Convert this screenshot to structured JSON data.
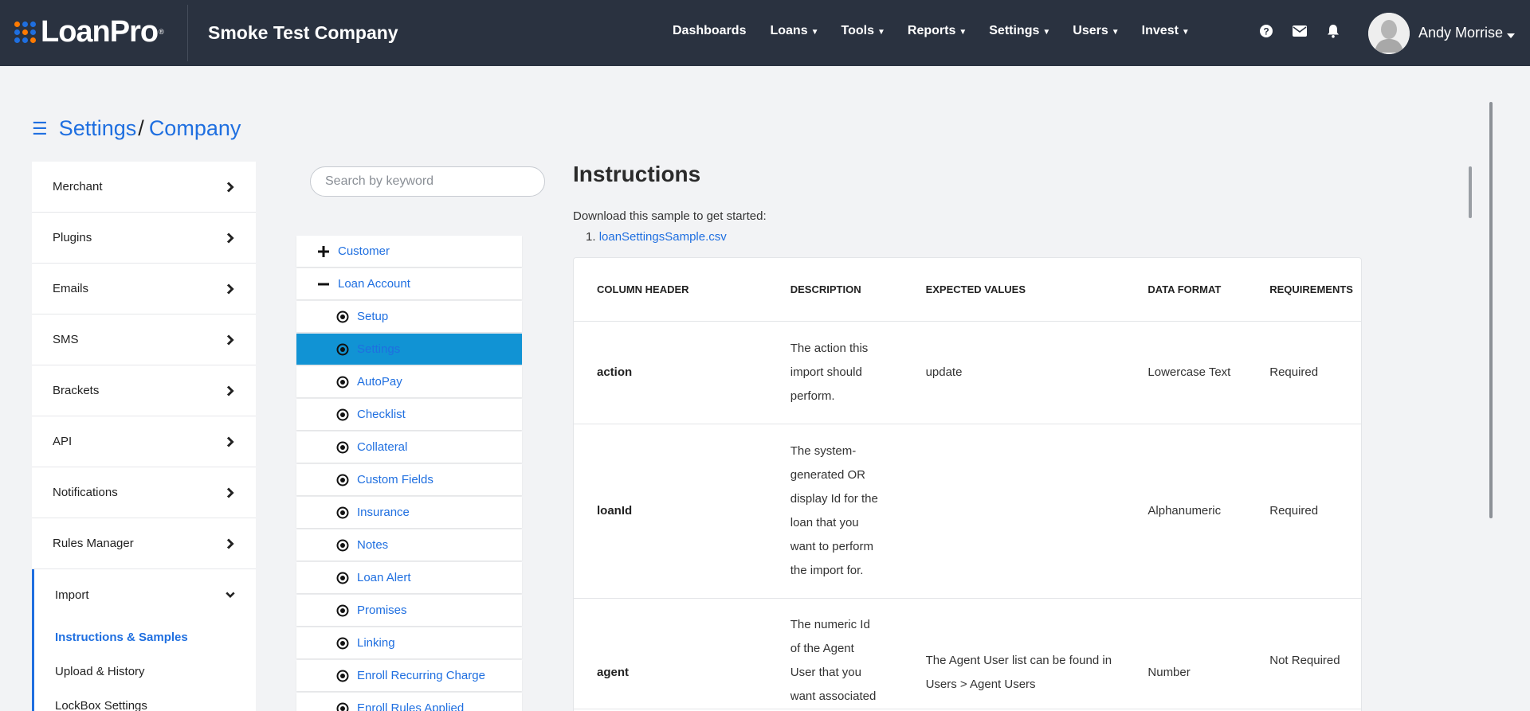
{
  "header": {
    "logo_text": "LoanPro",
    "logo_tm": "®",
    "company": "Smoke Test Company",
    "nav": [
      "Dashboards",
      "Loans",
      "Tools",
      "Reports",
      "Settings",
      "Users",
      "Invest"
    ],
    "user_name": "Andy Morrise",
    "logo_colors": [
      "#ff7a00",
      "#1f6fe0",
      "#1f6fe0",
      "#1f6fe0",
      "#ff7a00",
      "#1f6fe0",
      "#1f6fe0",
      "#1f6fe0",
      "#ff7a00"
    ]
  },
  "breadcrumb": {
    "root": "Settings",
    "separator": "/",
    "current": "Company"
  },
  "sidebar": {
    "items": [
      {
        "label": "Merchant"
      },
      {
        "label": "Plugins"
      },
      {
        "label": "Emails"
      },
      {
        "label": "SMS"
      },
      {
        "label": "Brackets"
      },
      {
        "label": "API"
      },
      {
        "label": "Notifications"
      },
      {
        "label": "Rules Manager"
      }
    ],
    "open_item": "Import",
    "sub_items": [
      "Instructions & Samples",
      "Upload & History",
      "LockBox Settings"
    ]
  },
  "search": {
    "placeholder": "Search by keyword"
  },
  "tree": {
    "top": [
      {
        "label": "Customer",
        "expanded": false
      },
      {
        "label": "Loan Account",
        "expanded": true
      }
    ],
    "children": [
      "Setup",
      "Settings",
      "AutoPay",
      "Checklist",
      "Collateral",
      "Custom Fields",
      "Insurance",
      "Notes",
      "Loan Alert",
      "Promises",
      "Linking",
      "Enroll Recurring Charge",
      "Enroll Rules Applied"
    ],
    "selected": "Settings"
  },
  "instructions": {
    "title": "Instructions",
    "intro": "Download this sample to get started:",
    "list_number": "1.",
    "sample_link": "loanSettingsSample.csv",
    "columns": [
      "COLUMN HEADER",
      "DESCRIPTION",
      "EXPECTED VALUES",
      "DATA FORMAT",
      "REQUIREMENTS"
    ],
    "rows": [
      {
        "name": "action",
        "description": "The action this import should perform.",
        "expected": "update",
        "format": "Lowercase Text",
        "requirement": "Required"
      },
      {
        "name": "loanId",
        "description": "The system-generated OR display Id for the loan that you want to perform the import for.",
        "expected": "",
        "format": "Alphanumeric",
        "requirement": "Required"
      },
      {
        "name": "agent",
        "description": "The numeric Id of the Agent User that you want associated",
        "expected": "The Agent User list can be found in Users > Agent Users",
        "format": "Number",
        "requirement": "Not Required"
      }
    ]
  }
}
